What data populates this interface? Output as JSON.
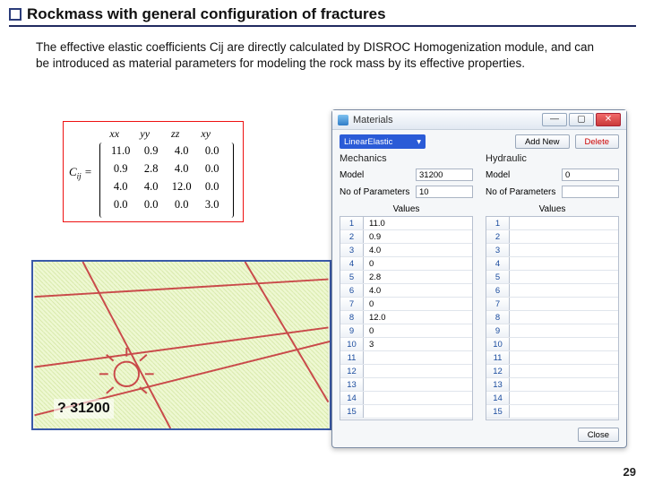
{
  "slide": {
    "title": "Rockmass with general configuration of fractures",
    "body": "The effective elastic coefficients Cij are directly calculated by  DISROC Homogenization module, and can be introduced as material parameters for modeling the rock mass by its effective properties.",
    "footer_label": "? 31200",
    "page_number": "29"
  },
  "matrix": {
    "label": "C_ij =",
    "headers": [
      "xx",
      "yy",
      "zz",
      "xy"
    ],
    "rows": [
      [
        "11.0",
        "0.9",
        "4.0",
        "0.0"
      ],
      [
        "0.9",
        "2.8",
        "4.0",
        "0.0"
      ],
      [
        "4.0",
        "4.0",
        "12.0",
        "0.0"
      ],
      [
        "0.0",
        "0.0",
        "0.0",
        "3.0"
      ]
    ]
  },
  "window": {
    "title": "Materials",
    "buttons": {
      "min": "—",
      "max": "▢",
      "close": "✕"
    },
    "dropdown": {
      "selected": "LinearElastic",
      "arrow": "▾"
    },
    "add_new_label": "Add New",
    "delete_label": "Delete",
    "close_label": "Close",
    "mechanics": {
      "title": "Mechanics",
      "model_label": "Model",
      "model_value": "31200",
      "nop_label": "No of Parameters",
      "nop_value": "10",
      "values_header": "Values",
      "rows": [
        {
          "n": "1",
          "v": "11.0"
        },
        {
          "n": "2",
          "v": "0.9"
        },
        {
          "n": "3",
          "v": "4.0"
        },
        {
          "n": "4",
          "v": "0"
        },
        {
          "n": "5",
          "v": "2.8"
        },
        {
          "n": "6",
          "v": "4.0"
        },
        {
          "n": "7",
          "v": "0"
        },
        {
          "n": "8",
          "v": "12.0"
        },
        {
          "n": "9",
          "v": "0"
        },
        {
          "n": "10",
          "v": "3"
        },
        {
          "n": "11",
          "v": ""
        },
        {
          "n": "12",
          "v": ""
        },
        {
          "n": "13",
          "v": ""
        },
        {
          "n": "14",
          "v": ""
        },
        {
          "n": "15",
          "v": ""
        }
      ]
    },
    "hydraulic": {
      "title": "Hydraulic",
      "model_label": "Model",
      "model_value": "0",
      "nop_label": "No of Parameters",
      "nop_value": "",
      "values_header": "Values",
      "rows": [
        {
          "n": "1",
          "v": ""
        },
        {
          "n": "2",
          "v": ""
        },
        {
          "n": "3",
          "v": ""
        },
        {
          "n": "4",
          "v": ""
        },
        {
          "n": "5",
          "v": ""
        },
        {
          "n": "6",
          "v": ""
        },
        {
          "n": "7",
          "v": ""
        },
        {
          "n": "8",
          "v": ""
        },
        {
          "n": "9",
          "v": ""
        },
        {
          "n": "10",
          "v": ""
        },
        {
          "n": "11",
          "v": ""
        },
        {
          "n": "12",
          "v": ""
        },
        {
          "n": "13",
          "v": ""
        },
        {
          "n": "14",
          "v": ""
        },
        {
          "n": "15",
          "v": ""
        }
      ]
    }
  }
}
